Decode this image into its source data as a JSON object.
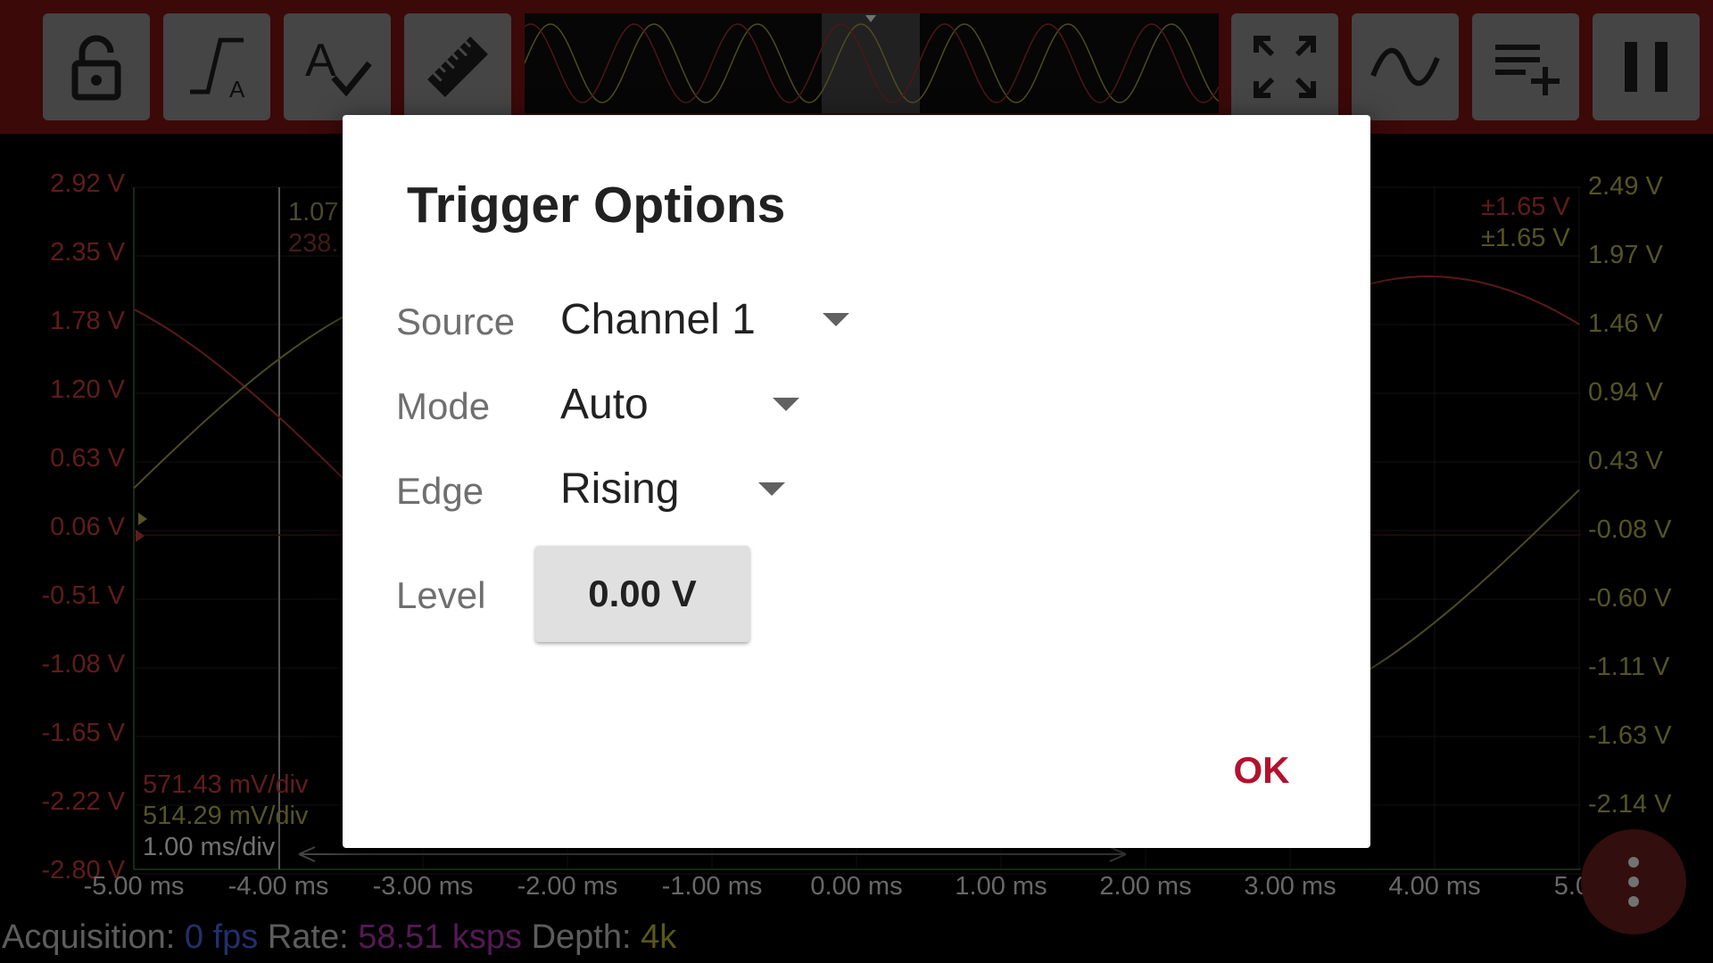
{
  "toolbar": {
    "buttons_left": [
      {
        "name": "lock-button",
        "icon": "lock-icon"
      },
      {
        "name": "trigger-button",
        "icon": "trigger-icon"
      },
      {
        "name": "autoset-button",
        "icon": "autoset-check-icon"
      },
      {
        "name": "measure-button",
        "icon": "ruler-icon"
      }
    ],
    "buttons_right": [
      {
        "name": "fullscreen-button",
        "icon": "expand-arrows-icon"
      },
      {
        "name": "waveform-button",
        "icon": "sine-wave-icon"
      },
      {
        "name": "add-to-list-button",
        "icon": "playlist-add-icon"
      },
      {
        "name": "pause-button",
        "icon": "pause-icon"
      }
    ]
  },
  "plot": {
    "left_axis": [
      "2.92 V",
      "2.35 V",
      "1.78 V",
      "1.20 V",
      "0.63 V",
      "0.06 V",
      "-0.51 V",
      "-1.08 V",
      "-1.65 V",
      "-2.22 V",
      "-2.80 V"
    ],
    "right_axis": [
      "2.49 V",
      "1.97 V",
      "1.46 V",
      "0.94 V",
      "0.43 V",
      "-0.08 V",
      "-0.60 V",
      "-1.11 V",
      "-1.63 V",
      "-2.14 V"
    ],
    "x_axis": [
      "-5.00 ms",
      "-4.00 ms",
      "-3.00 ms",
      "-2.00 ms",
      "-1.00 ms",
      "0.00 ms",
      "1.00 ms",
      "2.00 ms",
      "3.00 ms",
      "4.00 ms",
      "5.00"
    ],
    "cursor_readout": [
      "1.07",
      "238."
    ],
    "range_ch1": "±1.65 V",
    "range_ch2": "±1.65 V",
    "scale_ch1": "571.43 mV/div",
    "scale_ch2": "514.29 mV/div",
    "timebase": "1.00 ms/div"
  },
  "status": {
    "acq_label": "Acquisition:",
    "acq_value": "0 fps",
    "rate_label": "Rate:",
    "rate_value": "58.51 ksps",
    "depth_label": "Depth:",
    "depth_value": "4k"
  },
  "dialog": {
    "title": "Trigger Options",
    "source_label": "Source",
    "source_value": "Channel 1",
    "mode_label": "Mode",
    "mode_value": "Auto",
    "edge_label": "Edge",
    "edge_value": "Rising",
    "level_label": "Level",
    "level_value": "0.00 V",
    "ok_label": "OK"
  },
  "colors": {
    "accent": "#b3112e",
    "toolbar": "#7c1414",
    "channel1": "#b03434",
    "channel2": "#9c9a43",
    "rate": "#9c2f9c",
    "acquisition": "#3e58c4"
  }
}
